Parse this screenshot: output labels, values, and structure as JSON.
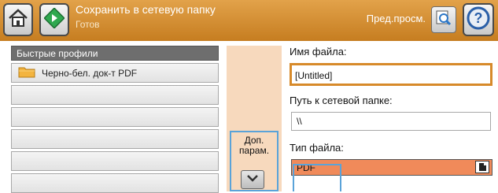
{
  "header": {
    "title": "Сохранить в сетевую папку",
    "status": "Готов",
    "preview_label": "Пред.просм.",
    "icons": {
      "home": "home-icon",
      "start": "start-icon",
      "preview": "magnifier-icon",
      "help": "help-icon"
    },
    "colors": {
      "bar": "#c67d20"
    }
  },
  "profiles": {
    "header": "Быстрые профили",
    "items": [
      {
        "label": "Черно-бел. док-т PDF",
        "icon": "folder-icon"
      },
      {
        "label": ""
      },
      {
        "label": ""
      },
      {
        "label": ""
      },
      {
        "label": ""
      }
    ]
  },
  "middle": {
    "more_label": "Доп. парам.",
    "down_icon": "chevron-down-icon"
  },
  "form": {
    "file_name_label": "Имя файла:",
    "file_name_value": "[Untitled]",
    "network_path_label": "Путь к сетевой папке:",
    "network_path_value": "\\\\",
    "file_type_label": "Тип файла:",
    "file_type_value": "PDF"
  }
}
